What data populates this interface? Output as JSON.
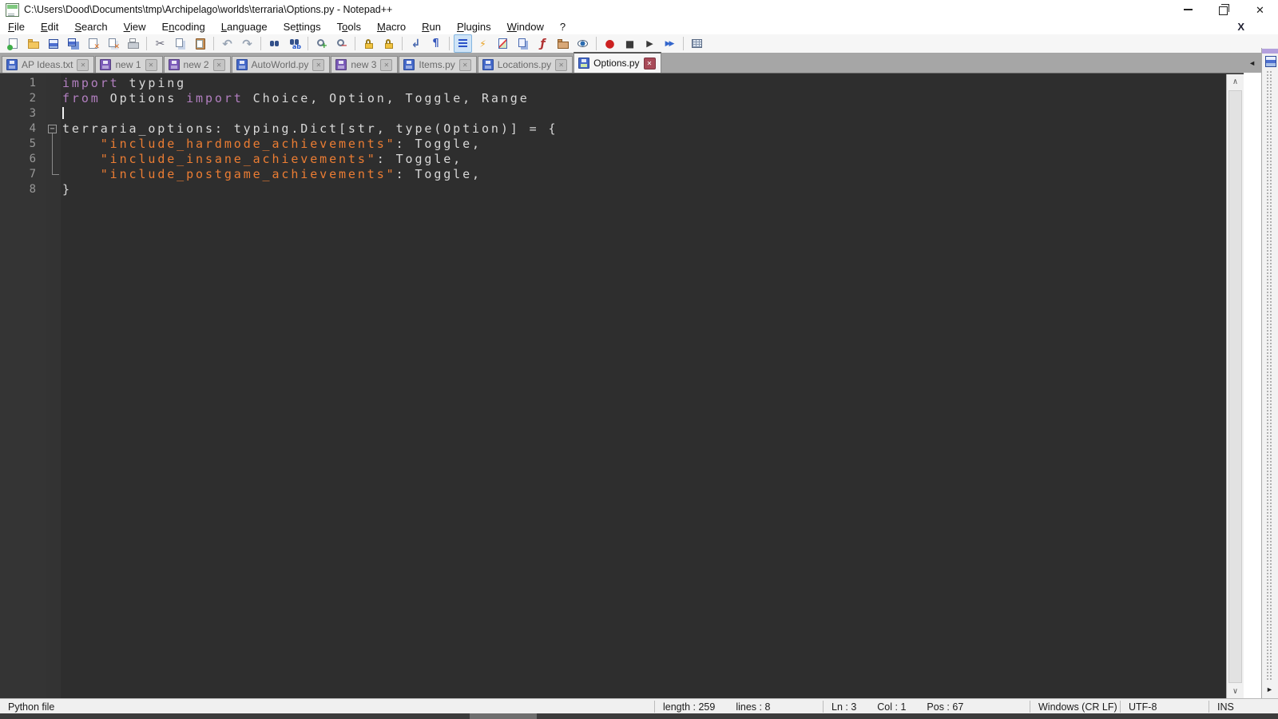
{
  "window": {
    "title": "C:\\Users\\Dood\\Documents\\tmp\\Archipelago\\worlds\\terraria\\Options.py - Notepad++",
    "controls": [
      {
        "name": "minimize"
      },
      {
        "name": "restore"
      },
      {
        "name": "close"
      }
    ]
  },
  "menu": {
    "items": [
      {
        "label": "File",
        "accel": 0
      },
      {
        "label": "Edit",
        "accel": 0
      },
      {
        "label": "Search",
        "accel": 0
      },
      {
        "label": "View",
        "accel": 0
      },
      {
        "label": "Encoding",
        "accel": 1
      },
      {
        "label": "Language",
        "accel": 0
      },
      {
        "label": "Settings",
        "accel": 2
      },
      {
        "label": "Tools",
        "accel": 1
      },
      {
        "label": "Macro",
        "accel": 0
      },
      {
        "label": "Run",
        "accel": 0
      },
      {
        "label": "Plugins",
        "accel": 0
      },
      {
        "label": "Window",
        "accel": 0
      },
      {
        "label": "?",
        "accel": -1
      }
    ],
    "close_document_glyph": "X"
  },
  "toolbar": {
    "buttons": [
      {
        "name": "new-file",
        "icon": "page-new"
      },
      {
        "name": "open-file",
        "icon": "folder-open"
      },
      {
        "name": "save",
        "icon": "floppy"
      },
      {
        "name": "save-all",
        "icon": "floppy-all"
      },
      {
        "name": "close-file",
        "icon": "page-close"
      },
      {
        "name": "close-all",
        "icon": "pages-closeall"
      },
      {
        "name": "print",
        "icon": "printer"
      },
      {
        "sep": true
      },
      {
        "name": "cut",
        "icon": "scissors"
      },
      {
        "name": "copy",
        "icon": "pages-copy"
      },
      {
        "name": "paste",
        "icon": "clipboard"
      },
      {
        "sep": true
      },
      {
        "name": "undo",
        "icon": "undo"
      },
      {
        "name": "redo",
        "icon": "redo"
      },
      {
        "sep": true
      },
      {
        "name": "find",
        "icon": "binoculars"
      },
      {
        "name": "replace",
        "icon": "replace"
      },
      {
        "sep": true
      },
      {
        "name": "zoom-in",
        "icon": "zoom-in"
      },
      {
        "name": "zoom-out",
        "icon": "zoom-out"
      },
      {
        "sep": true
      },
      {
        "name": "sync-vertical-scrolling",
        "icon": "lock"
      },
      {
        "name": "sync-horizontal-scrolling",
        "icon": "lock"
      },
      {
        "sep": true
      },
      {
        "name": "word-wrap",
        "icon": "word-wrap"
      },
      {
        "name": "show-all-characters",
        "icon": "pilcrow"
      },
      {
        "sep": true
      },
      {
        "name": "show-indent-guide",
        "icon": "indent-guide",
        "pressed": true
      },
      {
        "name": "define-language",
        "icon": "bolt"
      },
      {
        "name": "document-map",
        "icon": "doc-map"
      },
      {
        "name": "document-list",
        "icon": "doc-list"
      },
      {
        "name": "function-list",
        "icon": "function-list"
      },
      {
        "name": "folder-as-workspace",
        "icon": "folder-ws"
      },
      {
        "name": "monitoring",
        "icon": "monitoring"
      },
      {
        "sep": true
      },
      {
        "name": "macro-record",
        "icon": "record"
      },
      {
        "name": "macro-stop",
        "icon": "stop"
      },
      {
        "name": "macro-playback",
        "icon": "play"
      },
      {
        "name": "macro-run-multiple",
        "icon": "play-multi"
      },
      {
        "sep": true
      },
      {
        "name": "save-recorded-macro",
        "icon": "grid"
      }
    ]
  },
  "tabs": [
    {
      "label": "AP Ideas.txt",
      "state": "saved",
      "active": false
    },
    {
      "label": "new 1",
      "state": "modified",
      "active": false
    },
    {
      "label": "new 2",
      "state": "modified",
      "active": false
    },
    {
      "label": "AutoWorld.py",
      "state": "saved",
      "active": false
    },
    {
      "label": "new 3",
      "state": "modified",
      "active": false
    },
    {
      "label": "Items.py",
      "state": "saved",
      "active": false
    },
    {
      "label": "Locations.py",
      "state": "saved",
      "active": false
    },
    {
      "label": "Options.py",
      "state": "saved",
      "active": true
    }
  ],
  "tabbar": {
    "scroll_left_glyph": "◄"
  },
  "editor": {
    "caret": {
      "line": 3,
      "col": 1
    },
    "lines": [
      {
        "n": "1",
        "seg": [
          [
            "kw",
            "import"
          ],
          [
            "df",
            " typing"
          ]
        ]
      },
      {
        "n": "2",
        "seg": [
          [
            "kw",
            "from"
          ],
          [
            "df",
            " Options "
          ],
          [
            "kw",
            "import"
          ],
          [
            "df",
            " Choice, Option, Toggle, Range"
          ]
        ]
      },
      {
        "n": "3",
        "seg": [],
        "caret": true
      },
      {
        "n": "4",
        "seg": [
          [
            "df",
            "terraria_options: typing.Dict[str, type(Option)] = {"
          ]
        ],
        "fold": "open"
      },
      {
        "n": "5",
        "seg": [
          [
            "df",
            "    "
          ],
          [
            "str",
            "\"include_hardmode_achievements\""
          ],
          [
            "df",
            ": Toggle,"
          ]
        ],
        "guide": "mid"
      },
      {
        "n": "6",
        "seg": [
          [
            "df",
            "    "
          ],
          [
            "str",
            "\"include_insane_achievements\""
          ],
          [
            "df",
            ": Toggle,"
          ]
        ],
        "guide": "mid"
      },
      {
        "n": "7",
        "seg": [
          [
            "df",
            "    "
          ],
          [
            "str",
            "\"include_postgame_achievements\""
          ],
          [
            "df",
            ": Toggle,"
          ]
        ],
        "guide": "end"
      },
      {
        "n": "8",
        "seg": [
          [
            "df",
            "}"
          ]
        ]
      }
    ],
    "colors": {
      "background": "#2e2e2e",
      "keyword": "#b27fc0",
      "string": "#ec7d33",
      "default": "#d8d8d8",
      "line_number": "#989898"
    }
  },
  "scrollbar": {
    "up_glyph": "∧",
    "down_glyph": "∨"
  },
  "right_panel": {
    "collapsed_arrow_glyph": "►"
  },
  "statusbar": {
    "doc_type": "Python file",
    "length": "length : 259",
    "lines": "lines : 8",
    "ln": "Ln : 3",
    "col": "Col : 1",
    "pos": "Pos : 67",
    "eol": "Windows (CR LF)",
    "encoding": "UTF-8",
    "mode": "INS"
  }
}
